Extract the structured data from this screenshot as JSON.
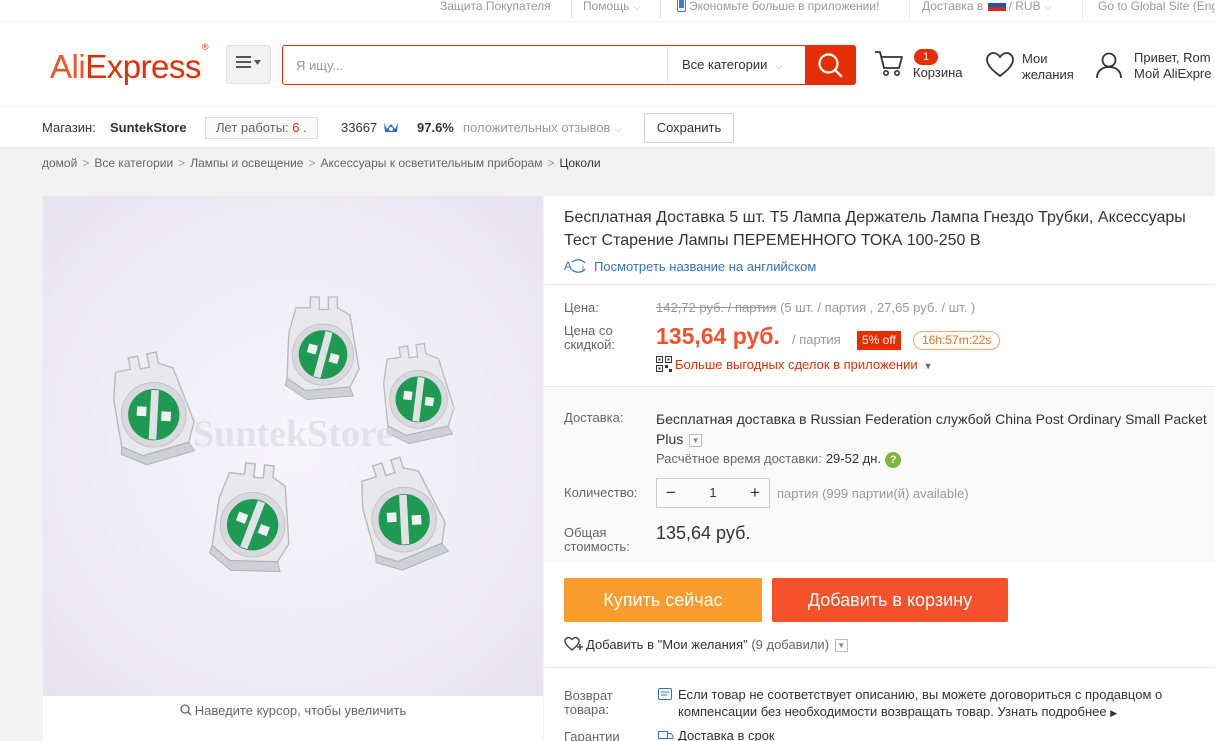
{
  "topbar": {
    "buyer_protection": "Защита Покупателя",
    "help": "Помощь",
    "app_savings": "Экономьте больше в приложении!",
    "ship_to": "Доставка в",
    "currency": "/ RUB",
    "global_site": "Go to Global Site (Eng"
  },
  "header": {
    "logo_ali": "Ali",
    "logo_express": "Express",
    "logo_mark": "®",
    "search_placeholder": "Я ищу...",
    "category": "Все категории",
    "cart_count": "1",
    "cart_label": "Корзина",
    "wish_line1": "Мои",
    "wish_line2": "желания",
    "greeting": "Привет, Rom",
    "account": "Мой AliExpre"
  },
  "store": {
    "store_label": "Магазин:",
    "store_name": "SuntekStore",
    "years_label": "Лет работы:",
    "years_value": "6 .",
    "score": "33667",
    "positive_pct": "97.6%",
    "positive_label": "положительных отзывов",
    "save_button": "Сохранить"
  },
  "breadcrumbs": {
    "items": [
      "домой",
      "Все категории",
      "Лампы и освещение",
      "Аксессуары к осветительным приборам"
    ],
    "current": "Цоколи"
  },
  "gallery": {
    "watermark": "SuntekStore",
    "zoom_hint": "Наведите курсор, чтобы увеличить"
  },
  "product": {
    "title": "Бесплатная Доставка 5 шт. T5 Лампа Держатель Лампа Гнездо Трубки, Аксессуары Тест Старение Лампы ПЕРЕМЕННОГО ТОКА 100-250 В",
    "english_link": "Посмотреть название на английском",
    "price_label": "Цена:",
    "old_price": "142,72 руб. / партия",
    "old_price_detail": "(5 шт. / партия , 27,65 руб. / шт. )",
    "discount_label_1": "Цена со",
    "discount_label_2": "скидкой:",
    "new_price": "135,64 руб.",
    "per_lot": "/ партия",
    "discount_badge": "5% off",
    "timer": "16h:57m:22s",
    "app_deals": "Больше выгодных сделок в приложении",
    "shipping_label": "Доставка:",
    "shipping_bold": "Бесплатная доставка в",
    "shipping_text": "Russian Federation службой China Post Ordinary Small Packet Plus",
    "est_label": "Расчётное время доставки:",
    "est_value": "29-52 дн.",
    "quantity_label": "Количество:",
    "quantity_value": "1",
    "quantity_available": "партия (999 партии(й) available)",
    "total_label_1": "Общая",
    "total_label_2": "стоимость:",
    "total_value": "135,64 руб.",
    "buy_now": "Купить сейчас",
    "add_to_cart": "Добавить в корзину",
    "wishlist": "Добавить в \"Мои желания\"",
    "wishlist_count": "(9 добавили)",
    "return_label_1": "Возврат",
    "return_label_2": "товара:",
    "return_text": "Если товар не соответствует описанию, вы можете договориться с продавцом о компенсации без необходимости возвращать товар.",
    "return_more": "Узнать подробнее",
    "guarantee_label": "Гарантии",
    "guarantee_text": "Доставка в срок"
  },
  "colors": {
    "brand": "#e62e04",
    "buy_now": "#f99c2c",
    "add_to_cart": "#f5512a",
    "link": "#3073c6",
    "help_icon": "#7bb83b"
  },
  "icons": [
    "phone-icon",
    "russia-flag-icon",
    "menu-icon",
    "search-icon",
    "cart-icon",
    "heart-icon",
    "user-icon",
    "medal-icon",
    "translate-icon",
    "qr-icon",
    "help-icon",
    "minus-icon",
    "plus-icon",
    "zoom-icon",
    "return-icon",
    "guarantee-icon"
  ]
}
